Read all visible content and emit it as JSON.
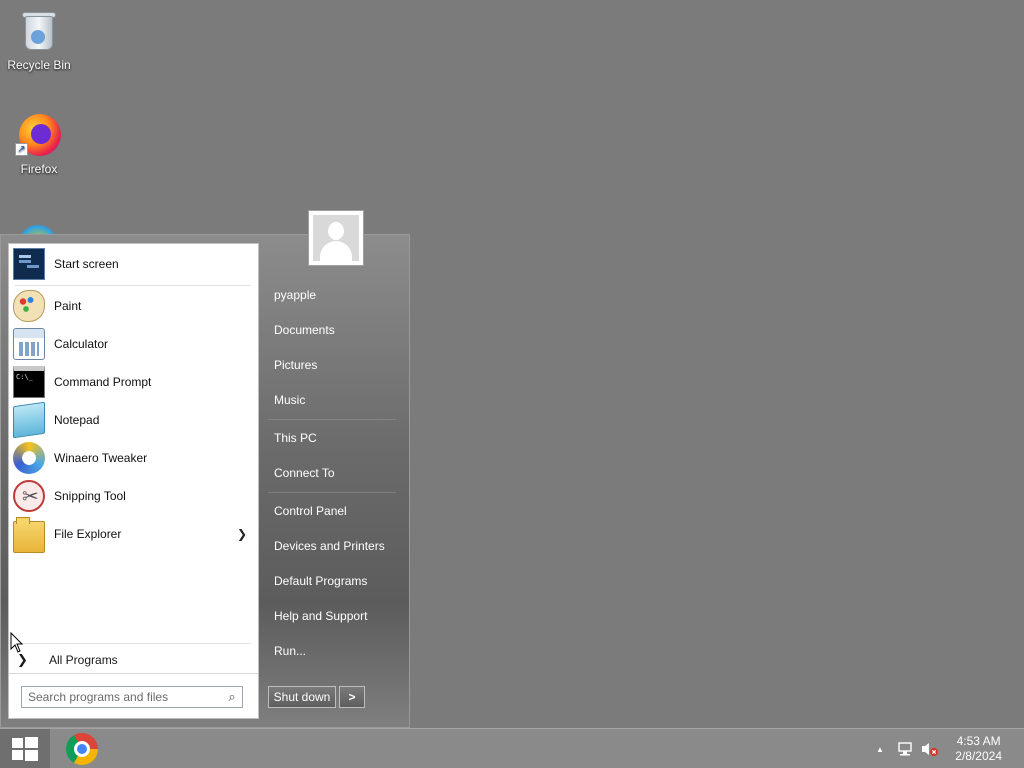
{
  "desktop": {
    "icons": [
      {
        "label": "Recycle Bin",
        "icon": "recycle-bin-icon"
      },
      {
        "label": "Firefox",
        "icon": "firefox-icon"
      }
    ]
  },
  "start_menu": {
    "pinned": [
      {
        "label": "Start screen",
        "icon": "start-screen-icon"
      }
    ],
    "recent": [
      {
        "label": "Paint",
        "icon": "paint-icon"
      },
      {
        "label": "Calculator",
        "icon": "calculator-icon"
      },
      {
        "label": "Command Prompt",
        "icon": "command-prompt-icon"
      },
      {
        "label": "Notepad",
        "icon": "notepad-icon"
      },
      {
        "label": "Winaero Tweaker",
        "icon": "winaero-tweaker-icon"
      },
      {
        "label": "Snipping Tool",
        "icon": "snipping-tool-icon"
      },
      {
        "label": "File Explorer",
        "icon": "file-explorer-icon",
        "has_submenu": true
      }
    ],
    "all_programs": "All Programs",
    "search": {
      "placeholder": "Search programs and files"
    },
    "right_pane": {
      "user": "pyapple",
      "group1": [
        "Documents",
        "Pictures",
        "Music"
      ],
      "group2": [
        "This PC",
        "Connect To"
      ],
      "group3": [
        "Control Panel",
        "Devices and Printers",
        "Default Programs",
        "Help and Support",
        "Run..."
      ]
    },
    "shutdown": {
      "label": "Shut down",
      "arrow": ">"
    }
  },
  "taskbar": {
    "pinned": [
      {
        "name": "Google Chrome",
        "icon": "chrome-icon"
      }
    ],
    "tray": {
      "show_hidden": "▲",
      "network_icon": "network-icon",
      "volume_icon": "volume-muted-icon"
    },
    "clock": {
      "time": "4:53 AM",
      "date": "2/8/2024"
    }
  },
  "colors": {
    "desktop": "#7b7b7b",
    "taskbar": "#8a8a8a",
    "menu_left": "#ffffff",
    "menu_right": "#6a6a6a"
  }
}
